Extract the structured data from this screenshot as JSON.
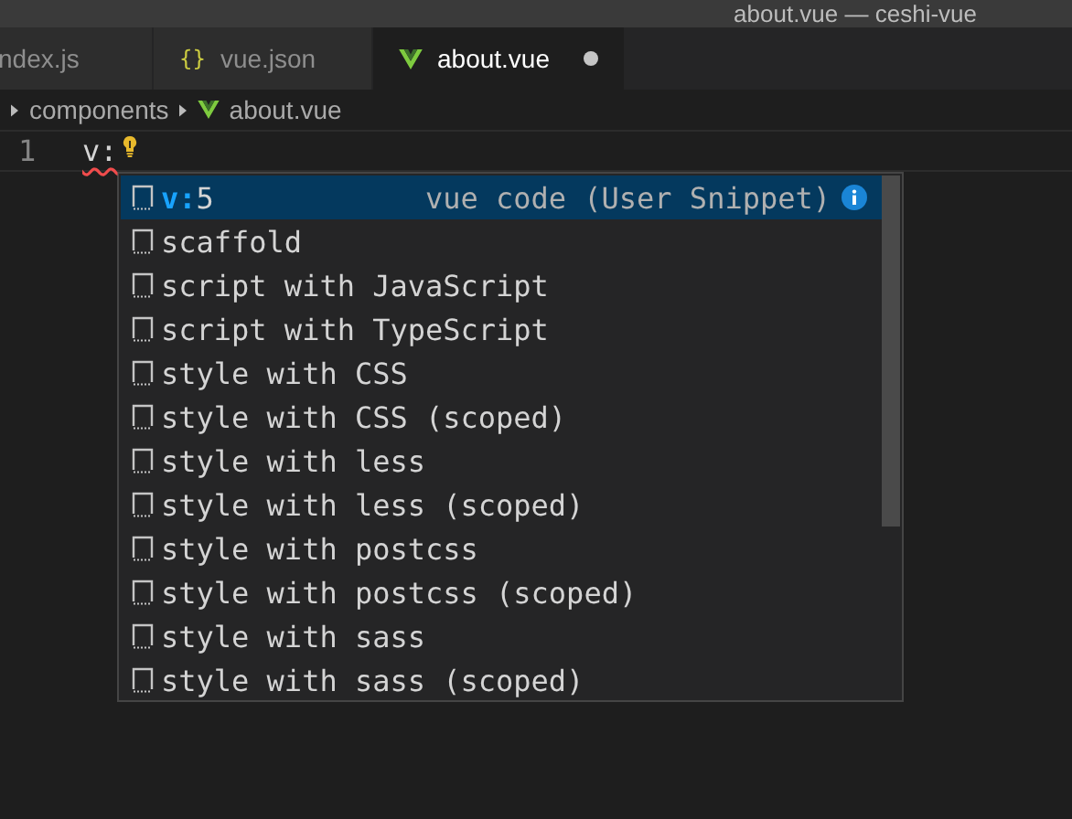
{
  "window": {
    "title": "about.vue — ceshi-vue"
  },
  "tabs": [
    {
      "label": "ndex.js",
      "kind": "js",
      "selected": false,
      "modified": false
    },
    {
      "label": "vue.json",
      "kind": "json",
      "icon_text": "{}",
      "selected": false,
      "modified": false
    },
    {
      "label": "about.vue",
      "kind": "vue",
      "selected": true,
      "modified": true
    }
  ],
  "breadcrumb": [
    {
      "label": "components",
      "kind": "folder"
    },
    {
      "label": "about.vue",
      "kind": "vue"
    }
  ],
  "editor": {
    "lines": [
      {
        "number": "1",
        "code": "v:",
        "error": true,
        "lightbulb": true
      }
    ]
  },
  "suggestions": [
    {
      "match": "v:",
      "rest": "5",
      "detail": "vue code (User Snippet)",
      "selected": true
    },
    {
      "rest": "scaffold",
      "selected": false
    },
    {
      "rest": "script with JavaScript",
      "selected": false
    },
    {
      "rest": "script with TypeScript",
      "selected": false
    },
    {
      "rest": "style with CSS",
      "selected": false
    },
    {
      "rest": "style with CSS (scoped)",
      "selected": false
    },
    {
      "rest": "style with less",
      "selected": false
    },
    {
      "rest": "style with less (scoped)",
      "selected": false
    },
    {
      "rest": "style with postcss",
      "selected": false
    },
    {
      "rest": "style with postcss (scoped)",
      "selected": false
    },
    {
      "rest": "style with sass",
      "selected": false
    },
    {
      "rest": "style with sass (scoped)",
      "selected": false
    }
  ]
}
